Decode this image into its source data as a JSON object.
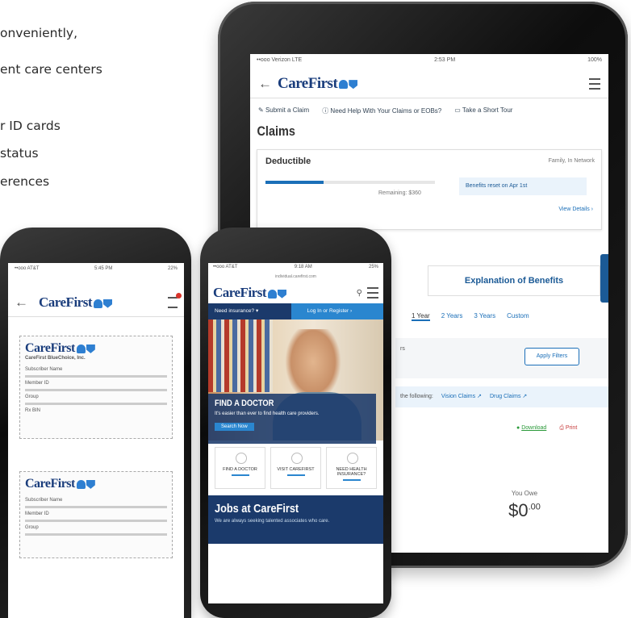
{
  "intro": {
    "bullets": [
      "onveniently,",
      "ent care centers",
      "r ID cards",
      "status",
      "erences"
    ]
  },
  "tablet": {
    "status_left": "••ooo Verizon LTE",
    "status_time": "2:53 PM",
    "status_right": "100%",
    "back_icon": "←",
    "logo_text": "CareFirst",
    "quick_links": [
      "Submit a Claim",
      "Need Help With Your Claims or EOBs?",
      "Take a Short Tour"
    ],
    "title": "Claims",
    "deductible": {
      "label": "Deductible",
      "scope": "Family, In Network",
      "remaining": "Remaining: $360",
      "reset": "Benefits reset on Apr 1st",
      "details": "View Details ›"
    },
    "tab_eob": "Explanation of Benefits",
    "years": [
      "1 Year",
      "2 Years",
      "3 Years",
      "Custom"
    ],
    "apply_filters": "Apply Filters",
    "filter_hint": "rs",
    "links_label": "the following:",
    "vision_claims": "Vision Claims ↗",
    "drug_claims": "Drug Claims ↗",
    "download": "Download",
    "print": "Print",
    "you_owe_label": "You Owe",
    "you_owe_value": "$0",
    "you_owe_cents": ".00"
  },
  "phone1": {
    "status_left": "••ooo AT&T",
    "status_time": "5:45 PM",
    "status_right": "22%",
    "logo_text": "CareFirst",
    "card1_sub": "CareFirst BlueChoice, Inc.",
    "card1_lines": [
      "Subscriber Name",
      "Member ID",
      "Group",
      "Rx BIN"
    ],
    "card2_lines": [
      "Subscriber Name",
      "Member ID",
      "Group"
    ]
  },
  "phone2": {
    "status_left": "••ooo AT&T",
    "status_time": "9:18 AM",
    "status_right": "25%",
    "url": "individual.carefirst.com",
    "logo_text": "CareFirst",
    "need_insurance": "Need insurance?",
    "login": "Log In or Register ›",
    "find_title": "FIND A DOCTOR",
    "find_sub": "It's easier than ever to find health care providers.",
    "search_now": "Search Now",
    "tiles": [
      "FIND A DOCTOR",
      "VISIT CAREFIRST",
      "NEED HEALTH INSURANCE?"
    ],
    "jobs_title": "Jobs at CareFirst",
    "jobs_sub": "We are always seeking talented associates who care."
  },
  "colors": {
    "brand_navy": "#1b3a6b",
    "brand_blue": "#2a86cf",
    "link_blue": "#1b6fb8"
  }
}
